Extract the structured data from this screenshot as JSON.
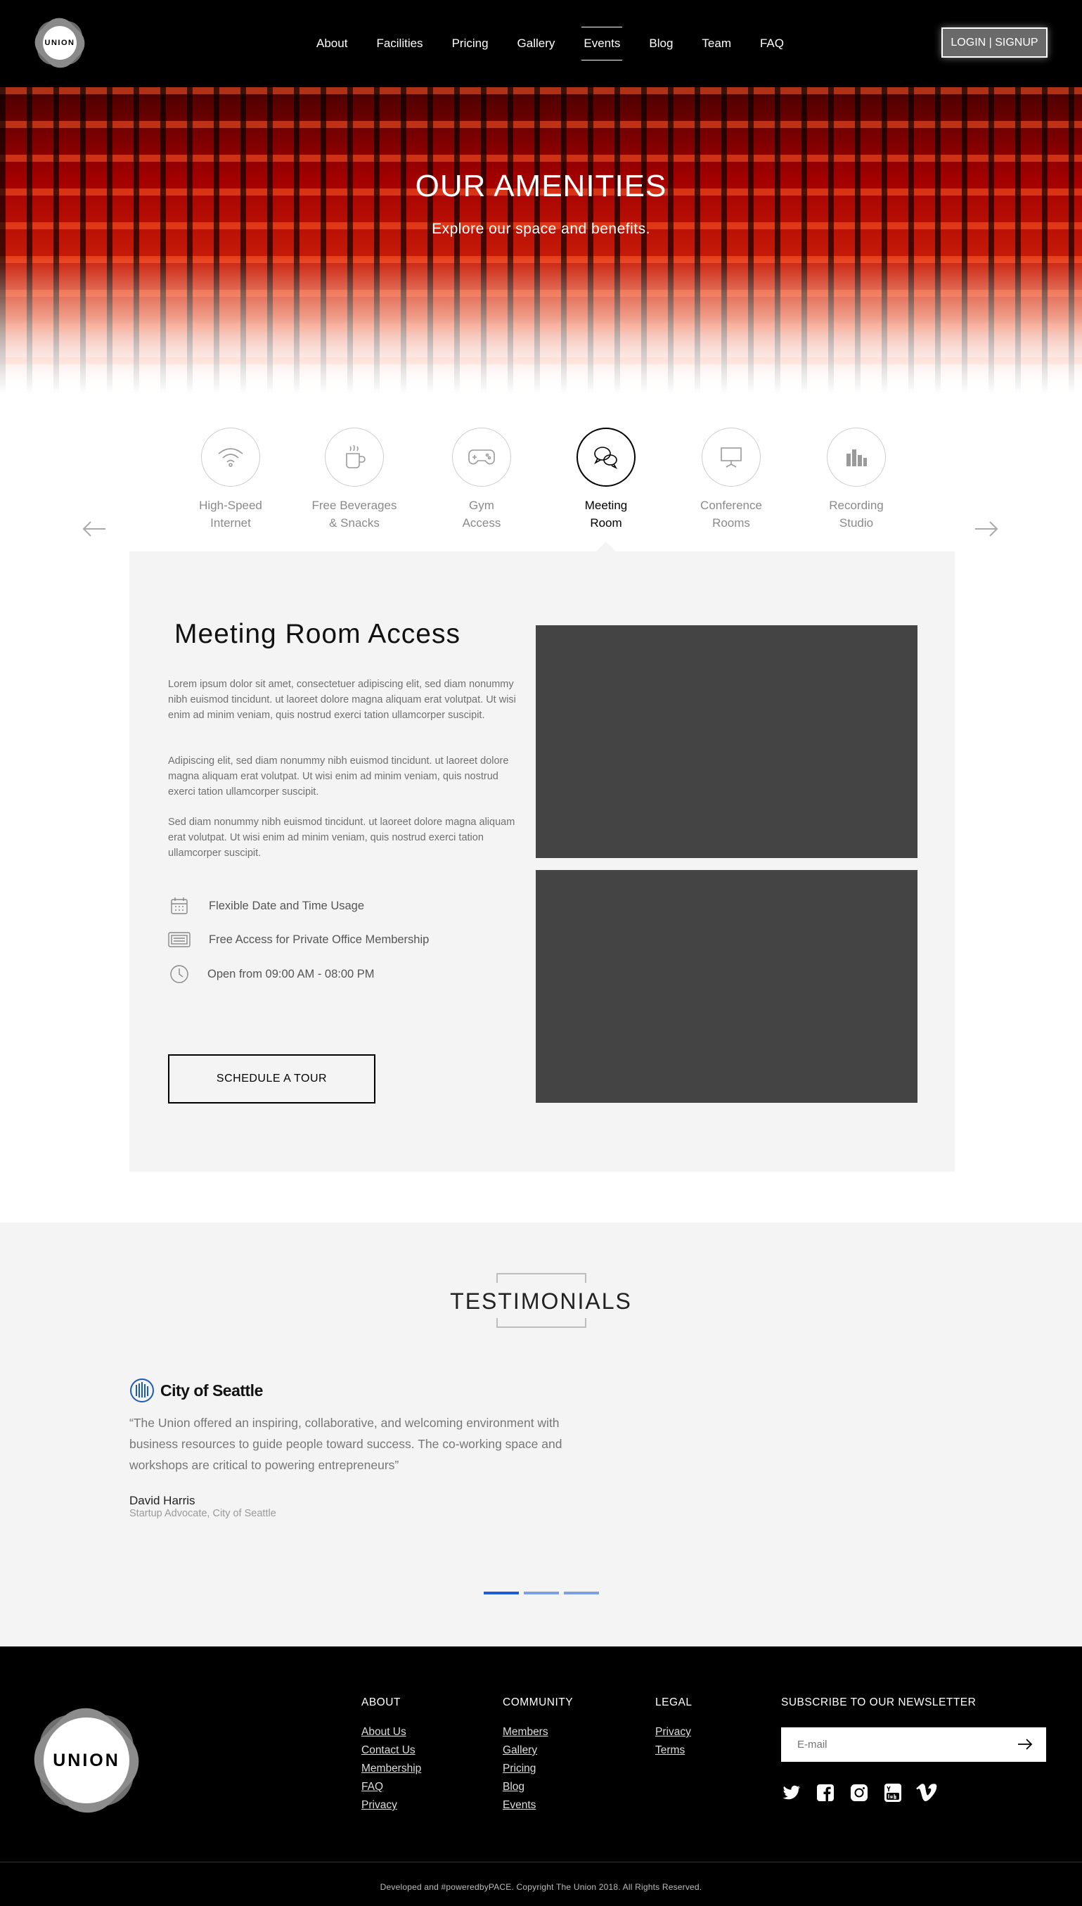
{
  "header": {
    "logo_text": "UNION",
    "nav": [
      "About",
      "Facilities",
      "Pricing",
      "Gallery",
      "Events",
      "Blog",
      "Team",
      "FAQ"
    ],
    "active_nav": "Events",
    "login_label": "LOGIN | SIGNUP"
  },
  "hero": {
    "title": "OUR AMENITIES",
    "subtitle": "Explore our space and benefits."
  },
  "amenities": {
    "tabs": [
      {
        "line1": "High-Speed",
        "line2": "Internet",
        "icon": "wifi-icon"
      },
      {
        "line1": "Free Beverages",
        "line2": "& Snacks",
        "icon": "coffee-cup-icon"
      },
      {
        "line1": "Gym",
        "line2": "Access",
        "icon": "gamepad-icon"
      },
      {
        "line1": "Meeting",
        "line2": "Room",
        "icon": "chat-bubbles-icon"
      },
      {
        "line1": "Conference",
        "line2": "Rooms",
        "icon": "presentation-board-icon"
      },
      {
        "line1": "Recording",
        "line2": "Studio",
        "icon": "equalizer-icon"
      }
    ],
    "active_tab": "Meeting Room"
  },
  "detail": {
    "title": "Meeting Room Access",
    "paragraphs": [
      "Lorem ipsum dolor sit amet, consectetuer adipiscing elit, sed diam nonummy nibh euismod tincidunt. ut laoreet dolore magna aliquam erat volutpat. Ut wisi enim ad minim veniam, quis nostrud exerci tation ullamcorper suscipit.",
      "Adipiscing elit, sed diam nonummy nibh euismod tincidunt. ut laoreet dolore magna aliquam erat volutpat. Ut wisi enim ad minim veniam, quis nostrud exerci tation ullamcorper suscipit.",
      "Sed diam nonummy nibh euismod tincidunt. ut laoreet dolore magna aliquam erat volutpat. Ut wisi enim ad minim veniam, quis nostrud exerci tation ullamcorper suscipit."
    ],
    "features": [
      {
        "text": "Flexible Date and Time Usage",
        "icon": "calendar-icon"
      },
      {
        "text": "Free Access for Private Office Membership",
        "icon": "keyboard-icon"
      },
      {
        "text": "Open from 09:00 AM - 08:00 PM",
        "icon": "clock-icon"
      }
    ],
    "cta_label": "SCHEDULE A TOUR"
  },
  "testimonials": {
    "title": "TESTIMONIALS",
    "org_name": "City of Seattle",
    "quote": "“The Union offered an inspiring, collaborative, and welcoming environment with business resources to guide people toward success. The co-working space and workshops are critical to powering entrepreneurs”",
    "person": "David Harris",
    "role": "Startup Advocate, City of Seattle",
    "slides": 3,
    "active_slide": 1
  },
  "footer": {
    "logo_text": "UNION",
    "columns": [
      {
        "heading": "ABOUT",
        "links": [
          "About Us",
          "Contact Us",
          "Membership",
          "FAQ",
          "Privacy"
        ]
      },
      {
        "heading": "COMMUNITY",
        "links": [
          "Members",
          "Gallery",
          "Pricing",
          "Blog",
          "Events"
        ]
      },
      {
        "heading": "LEGAL",
        "links": [
          "Privacy",
          "Terms"
        ]
      }
    ],
    "newsletter": {
      "heading": "SUBSCRIBE TO OUR NEWSLETTER",
      "placeholder": "E-mail"
    },
    "socials": [
      "twitter-icon",
      "facebook-icon",
      "instagram-icon",
      "youtube-icon",
      "vimeo-icon"
    ],
    "copyright": "Developed and #poweredbyPACE. Copyright The Union 2018. All Rights Reserved."
  }
}
